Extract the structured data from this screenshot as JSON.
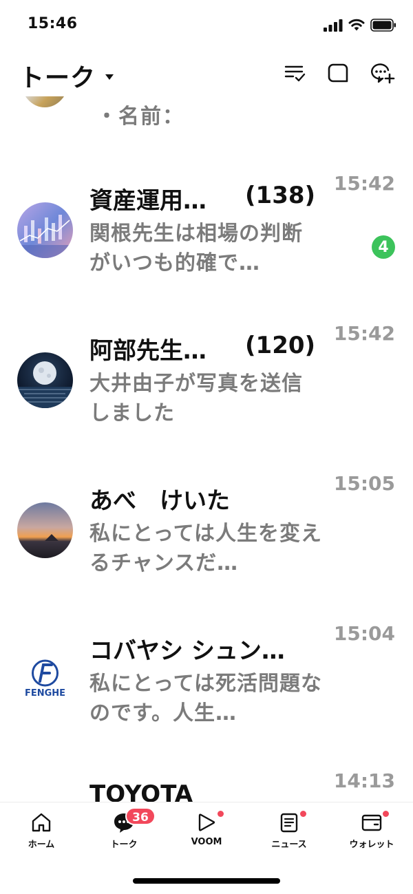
{
  "status_bar": {
    "time": "15:46"
  },
  "header": {
    "title": "トーク",
    "icons": [
      "filter-check-icon",
      "note-icon",
      "new-chat-icon"
    ]
  },
  "partial_row": {
    "text": "・名前："
  },
  "chats": [
    {
      "name": "資産運用…",
      "count": "(138)",
      "preview": "関根先生は相場の判断がいつも的確で…",
      "time": "15:42",
      "unread": "4"
    },
    {
      "name": "阿部先生…",
      "count": "(120)",
      "preview": "大井由子が写真を送信しました",
      "time": "15:42"
    },
    {
      "name": "あべ　けいた",
      "preview": "私にとっては人生を変えるチャンスだ…",
      "time": "15:05"
    },
    {
      "name": "コバヤシ シュン…",
      "preview": "私にとっては死活問題なのです。人生…",
      "time": "15:04",
      "avatar_text": "FENGHE"
    },
    {
      "name": "TOYOTA",
      "time": "14:13"
    }
  ],
  "tabs": [
    {
      "label": "ホーム",
      "icon": "home-icon"
    },
    {
      "label": "トーク",
      "icon": "chat-bubble-icon",
      "badge": "36"
    },
    {
      "label": "VOOM",
      "icon": "voom-play-icon"
    },
    {
      "label": "ニュース",
      "icon": "news-icon"
    },
    {
      "label": "ウォレット",
      "icon": "wallet-icon"
    }
  ],
  "colors": {
    "unread_badge": "#3cc35b",
    "notification_red": "#f2485b",
    "preview_text": "#7b7b7b"
  }
}
